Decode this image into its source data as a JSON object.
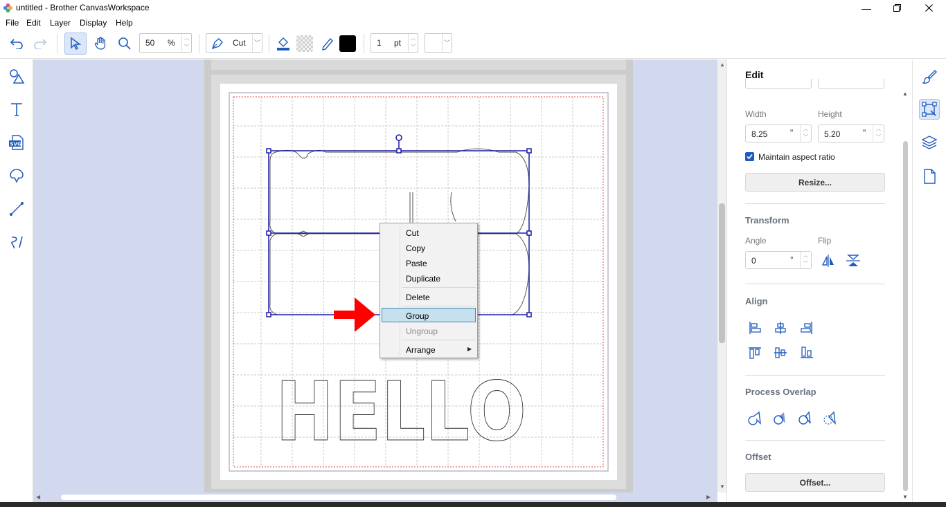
{
  "window": {
    "title": "untitled - Brother CanvasWorkspace"
  },
  "menubar": {
    "items": [
      "File",
      "Edit",
      "Layer",
      "Display",
      "Help"
    ]
  },
  "toolbar": {
    "zoom_value": "50",
    "zoom_unit": "%",
    "mode_label": "Cut",
    "line_width_value": "1",
    "line_width_unit": "pt",
    "line_color": "#000000"
  },
  "right_panel": {
    "title": "Edit",
    "width_label": "Width",
    "height_label": "Height",
    "width_value": "8.25",
    "height_value": "5.20",
    "unit": "\"",
    "maintain_aspect_label": "Maintain aspect ratio",
    "maintain_aspect_checked": true,
    "resize_button": "Resize...",
    "transform_heading": "Transform",
    "angle_label": "Angle",
    "flip_label": "Flip",
    "angle_value": "0",
    "angle_unit": "°",
    "align_heading": "Align",
    "process_overlap_heading": "Process Overlap",
    "offset_heading": "Offset",
    "offset_button": "Offset..."
  },
  "context_menu": {
    "items": [
      {
        "label": "Cut",
        "enabled": true
      },
      {
        "label": "Copy",
        "enabled": true
      },
      {
        "label": "Paste",
        "enabled": true
      },
      {
        "label": "Duplicate",
        "enabled": true
      },
      {
        "label": "Delete",
        "enabled": true
      },
      {
        "label": "Group",
        "enabled": true,
        "highlighted": true
      },
      {
        "label": "Ungroup",
        "enabled": false
      },
      {
        "label": "Arrange",
        "enabled": true,
        "submenu": true
      }
    ]
  },
  "canvas": {
    "text_shape": "HELLO"
  },
  "colors": {
    "accent": "#1e5bbf",
    "selection": "#1a1aa8",
    "arrow": "#ff0000",
    "canvas_bg": "#d2d9ef"
  }
}
